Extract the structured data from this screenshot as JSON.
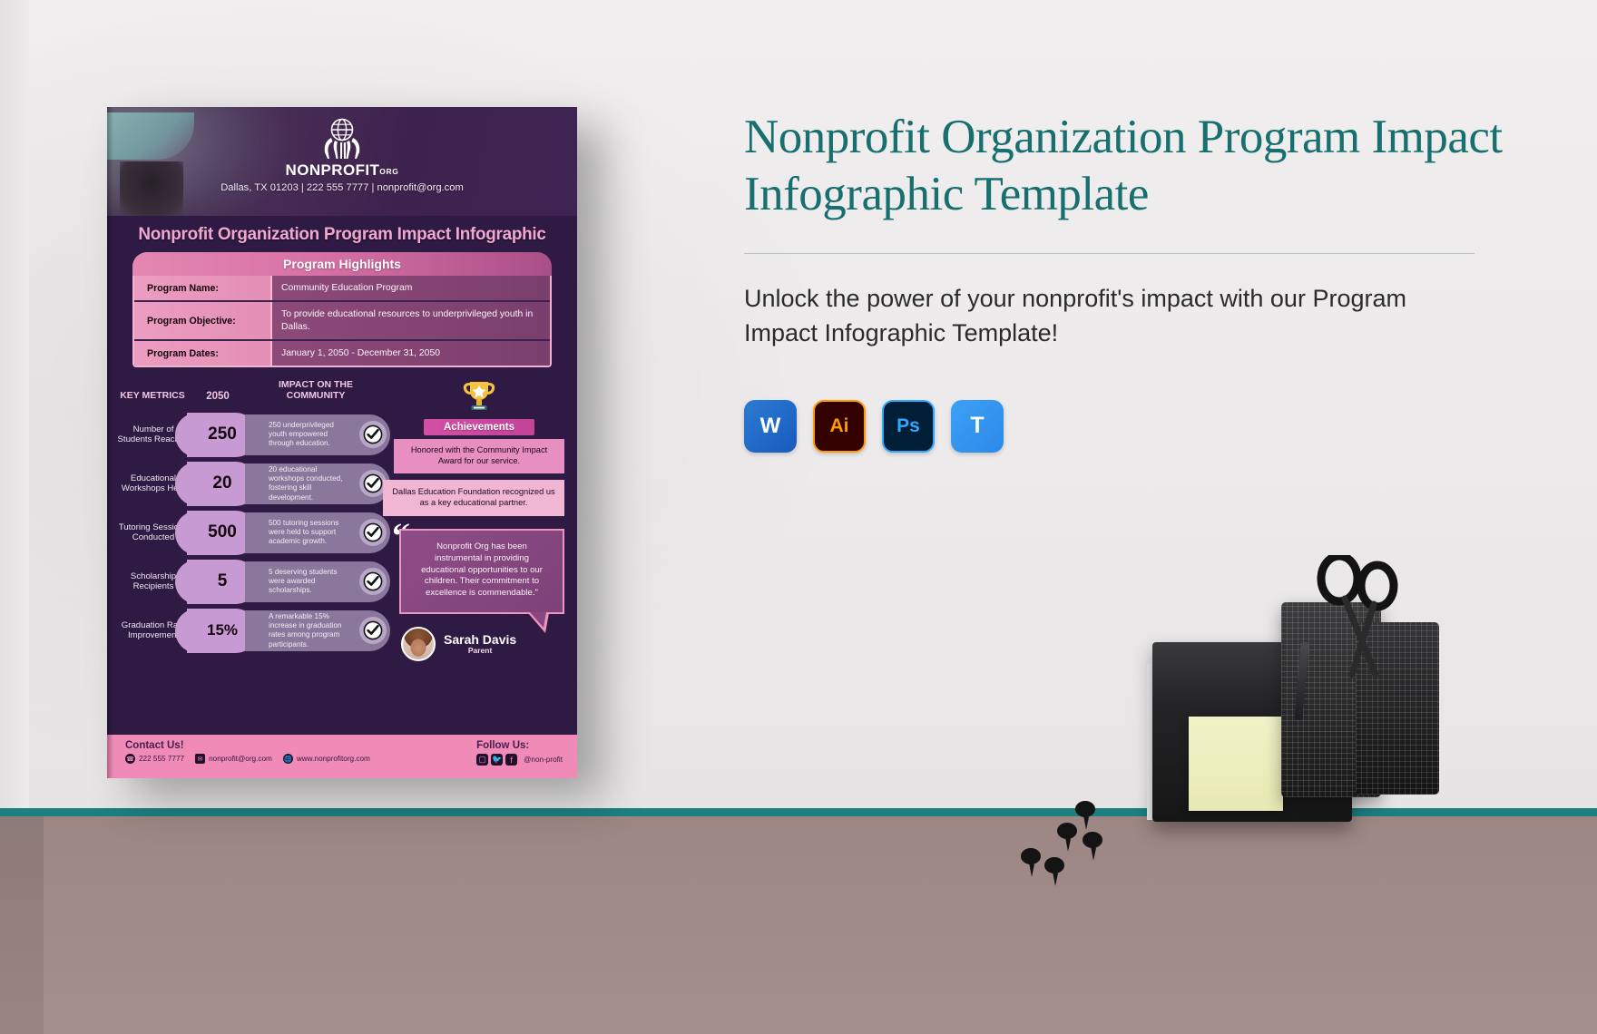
{
  "page": {
    "background_color": "#eceaea",
    "floor_color": "#a08a87",
    "accent_teal": "#17706f"
  },
  "flyer": {
    "header": {
      "logo_name": "NONPROFIT",
      "logo_suffix": "ORG",
      "contact_line": "Dallas, TX 01203 | 222 555 7777 | nonprofit@org.com"
    },
    "title": "Nonprofit Organization Program Impact Infographic",
    "highlights": {
      "heading": "Program Highlights",
      "rows": [
        {
          "label": "Program Name:",
          "value": "Community Education Program"
        },
        {
          "label": "Program Objective:",
          "value": "To provide educational resources to underprivileged youth in Dallas."
        },
        {
          "label": "Program Dates:",
          "value": "January 1, 2050 - December 31, 2050"
        }
      ]
    },
    "metrics": {
      "col_headers": {
        "metric": "KEY METRICS",
        "year": "2050",
        "impact": "IMPACT ON THE COMMUNITY"
      },
      "rows": [
        {
          "label": "Number of Students Reached",
          "value": "250",
          "impact": "250 underprivileged youth empowered through education."
        },
        {
          "label": "Educational Workshops Held",
          "value": "20",
          "impact": "20 educational workshops conducted, fostering skill development."
        },
        {
          "label": "Tutoring Sessions Conducted",
          "value": "500",
          "impact": "500 tutoring sessions were held to support academic growth."
        },
        {
          "label": "Scholarship Recipients",
          "value": "5",
          "impact": "5 deserving students were awarded scholarships."
        },
        {
          "label": "Graduation Rate Improvement",
          "value": "15%",
          "impact": "A remarkable 15% increase in graduation rates among program participants."
        }
      ]
    },
    "achievements": {
      "tab_label": "Achievements",
      "items": [
        "Honored with the Community Impact Award for our service.",
        "Dallas Education Foundation recognized us as a key educational partner."
      ]
    },
    "testimonial": {
      "quote": "Nonprofit Org has been instrumental in providing educational opportunities to our children. Their commitment to excellence is commendable.\"",
      "author_name": "Sarah Davis",
      "author_role": "Parent"
    },
    "footer": {
      "contact_title": "Contact Us!",
      "phone": "222 555 7777",
      "email": "nonprofit@org.com",
      "website": "www.nonprofitorg.com",
      "follow_title": "Follow Us:",
      "handle": "@non-profit",
      "social": [
        "instagram-icon",
        "twitter-icon",
        "facebook-icon"
      ]
    }
  },
  "panel": {
    "title": "Nonprofit Organization Program Impact Infographic Template",
    "subtitle": "Unlock the power of your nonprofit's impact with our Program Impact Infographic Template!",
    "apps": [
      {
        "name": "Microsoft Word",
        "glyph": "W",
        "key": "word"
      },
      {
        "name": "Adobe Illustrator",
        "glyph": "Ai",
        "key": "ai"
      },
      {
        "name": "Adobe Photoshop",
        "glyph": "Ps",
        "key": "ps"
      },
      {
        "name": "Template.net Editor",
        "glyph": "T",
        "key": "tp"
      }
    ]
  }
}
